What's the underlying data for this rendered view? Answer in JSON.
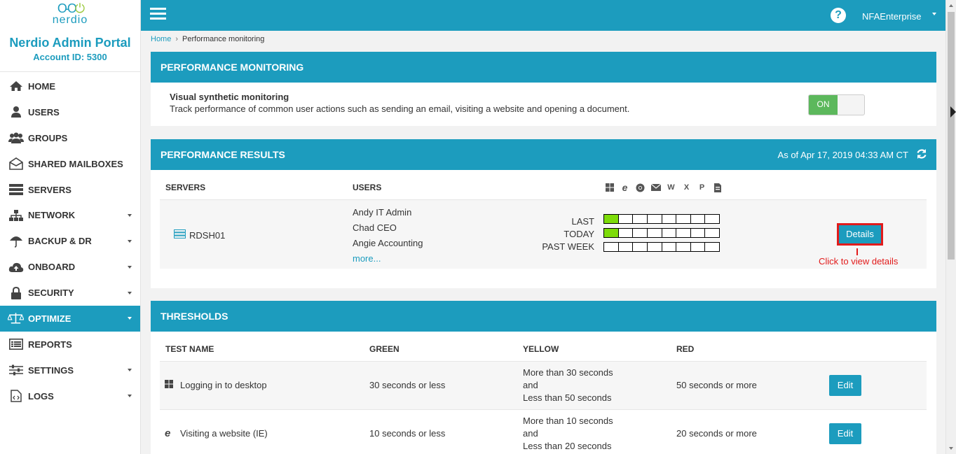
{
  "sidebar": {
    "logo_text": "nerdio",
    "title": "Nerdio Admin Portal",
    "account": "Account ID: 5300",
    "items": [
      {
        "label": "HOME",
        "icon": "home-icon",
        "caret": false
      },
      {
        "label": "USERS",
        "icon": "user-icon",
        "caret": false
      },
      {
        "label": "GROUPS",
        "icon": "users-icon",
        "caret": false
      },
      {
        "label": "SHARED MAILBOXES",
        "icon": "envelope-open-icon",
        "caret": false
      },
      {
        "label": "SERVERS",
        "icon": "server-icon",
        "caret": false
      },
      {
        "label": "NETWORK",
        "icon": "sitemap-icon",
        "caret": true
      },
      {
        "label": "BACKUP & DR",
        "icon": "umbrella-icon",
        "caret": true
      },
      {
        "label": "ONBOARD",
        "icon": "cloud-upload-icon",
        "caret": true
      },
      {
        "label": "SECURITY",
        "icon": "lock-icon",
        "caret": true
      },
      {
        "label": "OPTIMIZE",
        "icon": "balance-scale-icon",
        "caret": true,
        "active": true
      },
      {
        "label": "REPORTS",
        "icon": "list-alt-icon",
        "caret": false
      },
      {
        "label": "SETTINGS",
        "icon": "sliders-icon",
        "caret": true
      },
      {
        "label": "LOGS",
        "icon": "file-code-icon",
        "caret": true
      }
    ]
  },
  "topbar": {
    "user": "NFAEnterprise",
    "help": "?"
  },
  "breadcrumb": {
    "home": "Home",
    "current": "Performance monitoring"
  },
  "monitoring": {
    "header": "PERFORMANCE MONITORING",
    "title": "Visual synthetic monitoring",
    "description": "Track performance of common user actions such as sending an email, visiting a website and opening a document.",
    "toggle": "ON"
  },
  "results": {
    "header": "PERFORMANCE RESULTS",
    "as_of": "As of Apr 17, 2019 04:33 AM CT",
    "col_servers": "SERVERS",
    "col_users": "USERS",
    "app_icons": [
      "windows-icon",
      "ie-icon",
      "chrome-icon",
      "email-icon",
      "word-icon",
      "excel-icon",
      "powerpoint-icon",
      "pdf-icon"
    ],
    "server": "RDSH01",
    "users": [
      "Andy IT Admin",
      "Chad CEO",
      "Angie Accounting"
    ],
    "more": "more...",
    "labels": {
      "last": "LAST",
      "today": "TODAY",
      "past_week": "PAST WEEK"
    },
    "bars": {
      "last": [
        "green",
        "",
        "",
        "",
        "",
        "",
        "",
        ""
      ],
      "today": [
        "green",
        "",
        "",
        "",
        "",
        "",
        "",
        ""
      ],
      "past_week": [
        "",
        "",
        "",
        "",
        "",
        "",
        "",
        ""
      ]
    },
    "details_button": "Details",
    "callout": "Click to view details"
  },
  "thresholds": {
    "header": "THRESHOLDS",
    "columns": [
      "TEST NAME",
      "GREEN",
      "YELLOW",
      "RED"
    ],
    "rows": [
      {
        "icon": "windows-icon",
        "name": "Logging in to desktop",
        "green": "30 seconds or less",
        "yellow": [
          "More than 30 seconds",
          "and",
          "Less than 50 seconds"
        ],
        "red": "50 seconds or more",
        "action": "Edit"
      },
      {
        "icon": "ie-icon",
        "name": "Visiting a website (IE)",
        "green": "10 seconds or less",
        "yellow": [
          "More than 10 seconds",
          "and",
          "Less than 20 seconds"
        ],
        "red": "20 seconds or more",
        "action": "Edit"
      }
    ]
  },
  "colors": {
    "accent": "#1c9cbe",
    "green_cell": "#7ddc09",
    "toggle_on": "#5cb85c",
    "callout": "#e21b1b"
  }
}
